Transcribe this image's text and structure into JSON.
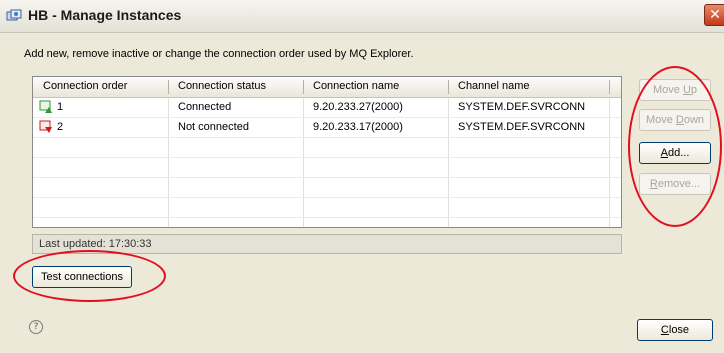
{
  "window": {
    "title": "HB - Manage Instances",
    "close_glyph": "✕"
  },
  "description": "Add new, remove inactive or change the connection order used by MQ Explorer.",
  "table": {
    "columns": [
      "Connection order",
      "Connection status",
      "Connection name",
      "Channel name"
    ],
    "rows": [
      {
        "order": "1",
        "status": "Connected",
        "name": "9.20.233.27(2000)",
        "channel": "SYSTEM.DEF.SVRCONN",
        "icon": "connected-queue-manager-icon"
      },
      {
        "order": "2",
        "status": "Not connected",
        "name": "9.20.233.17(2000)",
        "channel": "SYSTEM.DEF.SVRCONN",
        "icon": "disconnected-queue-manager-icon"
      }
    ]
  },
  "status": "Last updated: 17:30:33",
  "buttons": {
    "move_up": {
      "pre": "Move ",
      "key": "U",
      "post": "p"
    },
    "move_down": {
      "pre": "Move ",
      "key": "D",
      "post": "own"
    },
    "add": {
      "pre": "",
      "key": "A",
      "post": "dd..."
    },
    "remove": {
      "pre": "",
      "key": "R",
      "post": "emove..."
    },
    "test": "Test connections",
    "close": {
      "pre": "",
      "key": "C",
      "post": "lose"
    }
  },
  "help_glyph": "?",
  "colors": {
    "annotation": "#e2101f",
    "connected": "#2e9a2e",
    "disconnected": "#d21818"
  }
}
